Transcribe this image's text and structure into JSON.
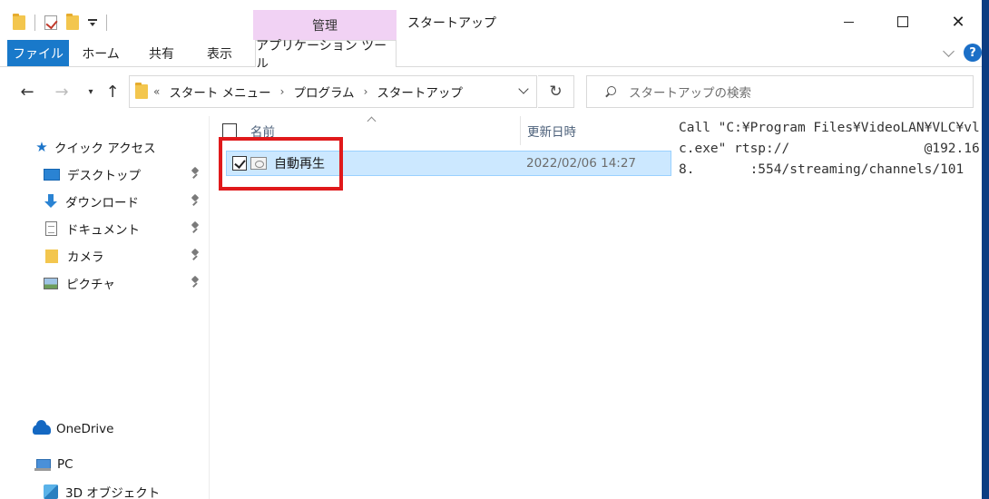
{
  "window": {
    "title": "スタートアップ",
    "context_tab": "管理",
    "close_glyph": "✕"
  },
  "ribbon": {
    "tabs": [
      "ファイル",
      "ホーム",
      "共有",
      "表示",
      "アプリケーション ツール"
    ],
    "help_label": "?"
  },
  "navigation": {
    "back_glyph": "←",
    "forward_glyph": "→",
    "recent_glyph": "▾",
    "up_glyph": "↑",
    "refresh_glyph": "↻",
    "breadcrumb_prefix": "«",
    "breadcrumb": [
      "スタート メニュー",
      "プログラム",
      "スタートアップ"
    ],
    "breadcrumb_sep": "›",
    "search_placeholder": "スタートアップの検索"
  },
  "sidebar": {
    "quick_access": "クイック アクセス",
    "items": [
      {
        "label": "デスクトップ",
        "icon": "desktop-icon",
        "pinned": true
      },
      {
        "label": "ダウンロード",
        "icon": "download-icon",
        "pinned": true
      },
      {
        "label": "ドキュメント",
        "icon": "document-icon",
        "pinned": true
      },
      {
        "label": "カメラ",
        "icon": "folder-icon",
        "pinned": true
      },
      {
        "label": "ピクチャ",
        "icon": "pictures-icon",
        "pinned": true
      }
    ],
    "onedrive": "OneDrive",
    "pc": "PC",
    "objects3d": "3D オブジェクト"
  },
  "file_list": {
    "columns": {
      "name": "名前",
      "date": "更新日時"
    },
    "rows": [
      {
        "name": "自動再生",
        "date": "2022/02/06 14:27",
        "selected": true,
        "checked": true
      }
    ]
  },
  "preview": {
    "text": "Call \"C:¥Program Files¥VideoLAN¥VLC¥vlc.exe\" rtsp://                 @192.168.       :554/streaming/channels/101"
  },
  "colors": {
    "accent": "#1979ca",
    "context_tab_bg": "#f1d2f4",
    "selection_bg": "#cce8ff",
    "highlight_border": "#e0191b"
  }
}
